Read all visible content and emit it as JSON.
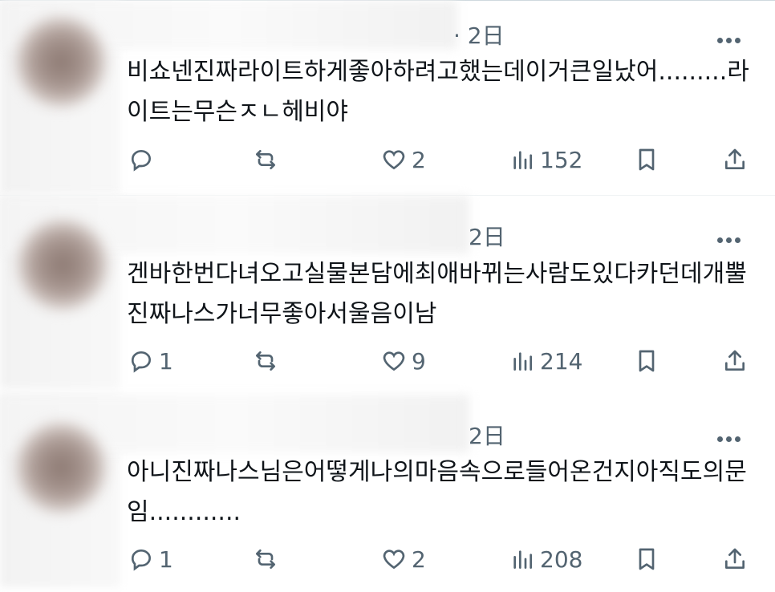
{
  "tweets": [
    {
      "time": "· 2日",
      "text": "비쇼넨진짜라이트하게좋아하려고했는데이거큰일났어.........라이트는무슨ㅈㄴ헤비야",
      "replies": "",
      "likes": "2",
      "views": "152"
    },
    {
      "time": "2日",
      "text": "겐바한번다녀오고실물본담에최애바뀌는사람도있다카던데개뿔진짜나스가너무좋아서울음이남",
      "replies": "1",
      "likes": "9",
      "views": "214"
    },
    {
      "time": "2日",
      "text": "아니진짜나스님은어떻게나의마음속으로들어온건지아직도의문임............",
      "replies": "1",
      "likes": "2",
      "views": "208"
    }
  ],
  "icons": {
    "reply": "reply-icon",
    "retweet": "retweet-icon",
    "like": "heart-icon",
    "views": "views-icon",
    "bookmark": "bookmark-icon",
    "share": "share-icon",
    "more": "more-icon"
  },
  "colors": {
    "text": "#0f1419",
    "muted": "#536471"
  }
}
